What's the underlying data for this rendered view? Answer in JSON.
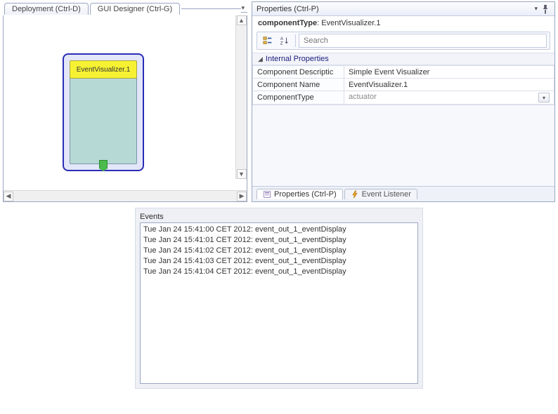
{
  "tabs": {
    "deployment": "Deployment (Ctrl-D)",
    "designer": "GUI Designer (Ctrl-G)"
  },
  "component": {
    "label": "EventVisualizer.1"
  },
  "properties": {
    "panel_title": "Properties (Ctrl-P)",
    "summary_key": "componentType",
    "summary_value": "EventVisualizer.1",
    "search_placeholder": "Search",
    "section": "Internal Properties",
    "rows": [
      {
        "key": "Component Descriptic",
        "value": "Simple Event Visualizer",
        "greyed": false,
        "combo": false
      },
      {
        "key": "Component Name",
        "value": "EventVisualizer.1",
        "greyed": false,
        "combo": false
      },
      {
        "key": "ComponentType",
        "value": "actuator",
        "greyed": true,
        "combo": true
      }
    ],
    "bottom_tabs": {
      "properties": "Properties (Ctrl-P)",
      "listener": "Event Listener"
    }
  },
  "events": {
    "label": "Events",
    "items": [
      "Tue Jan 24 15:41:00 CET 2012: event_out_1_eventDisplay",
      "Tue Jan 24 15:41:01 CET 2012: event_out_1_eventDisplay",
      "Tue Jan 24 15:41:02 CET 2012: event_out_1_eventDisplay",
      "Tue Jan 24 15:41:03 CET 2012: event_out_1_eventDisplay",
      "Tue Jan 24 15:41:04 CET 2012: event_out_1_eventDisplay"
    ]
  }
}
